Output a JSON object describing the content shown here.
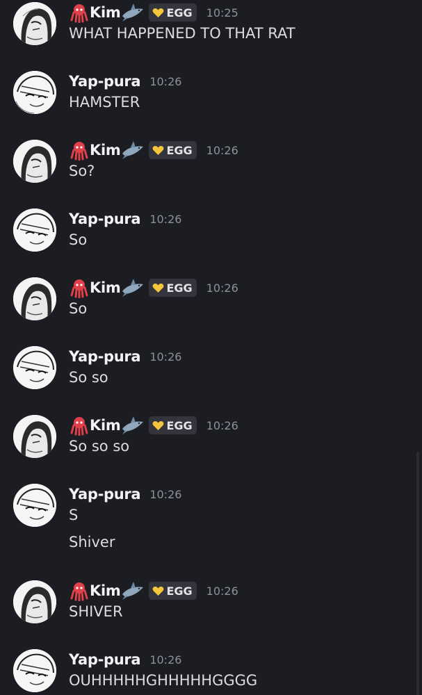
{
  "messages": [
    {
      "user": "Kim",
      "tag": "EGG",
      "time": "10:25",
      "lines": [
        "WHAT HAPPENED TO THAT RAT"
      ]
    },
    {
      "user": "Yap-pura",
      "time": "10:26",
      "lines": [
        "HAMSTER"
      ]
    },
    {
      "user": "Kim",
      "tag": "EGG",
      "time": "10:26",
      "lines": [
        "So?"
      ]
    },
    {
      "user": "Yap-pura",
      "time": "10:26",
      "lines": [
        "So"
      ]
    },
    {
      "user": "Kim",
      "tag": "EGG",
      "time": "10:26",
      "lines": [
        "So"
      ]
    },
    {
      "user": "Yap-pura",
      "time": "10:26",
      "lines": [
        "So so"
      ]
    },
    {
      "user": "Kim",
      "tag": "EGG",
      "time": "10:26",
      "lines": [
        "So so so"
      ]
    },
    {
      "user": "Yap-pura",
      "time": "10:26",
      "lines": [
        "S",
        "Shiver"
      ]
    },
    {
      "user": "Kim",
      "tag": "EGG",
      "time": "10:26",
      "lines": [
        "SHIVER"
      ]
    },
    {
      "user": "Yap-pura",
      "time": "10:26",
      "lines": [
        "OUHHHHHGHHHHHGGGG"
      ]
    }
  ],
  "icons": {
    "kim_prefix": "octopus-emoji",
    "kim_suffix": "shark-emoji",
    "tag_icon": "gold-heart-icon",
    "avatar": "manga-sketch-avatar"
  },
  "colors": {
    "background": "#1c1d22",
    "username": "#f2f3f5",
    "text": "#dcdde1",
    "timestamp": "#8f9199",
    "tag_bg": "#34353c",
    "octopus": "#e0404a",
    "heart": "#f5c53b"
  }
}
